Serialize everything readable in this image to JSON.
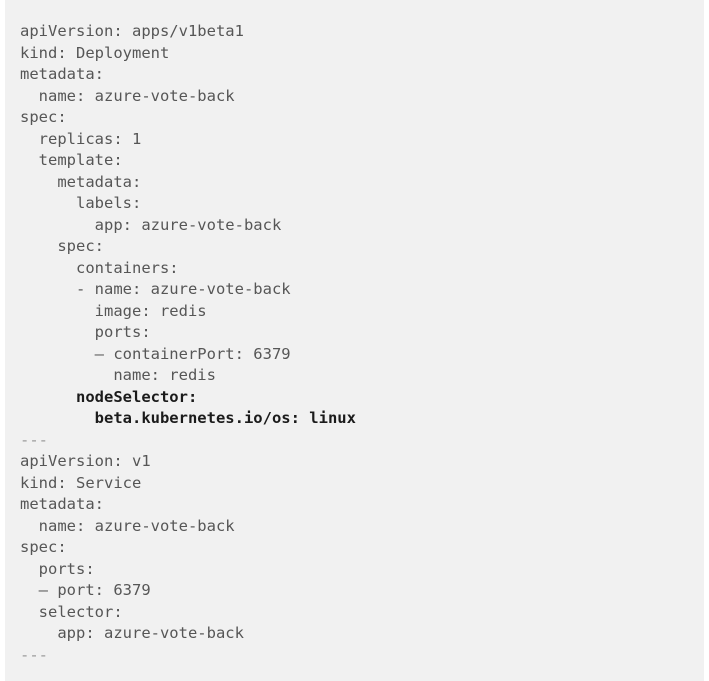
{
  "document": {
    "kind": "code-block",
    "language": "yaml",
    "background_color": "#f1f1f1",
    "page_background_color": "#ffffff",
    "text_color": "#565656",
    "emphasis_color": "#1b1b1b",
    "separator_color": "#9a9a9a",
    "lines": [
      {
        "text": "apiVersion: apps/v1beta1",
        "style": "normal"
      },
      {
        "text": "kind: Deployment",
        "style": "normal"
      },
      {
        "text": "metadata:",
        "style": "normal"
      },
      {
        "text": "  name: azure-vote-back",
        "style": "normal"
      },
      {
        "text": "spec:",
        "style": "normal"
      },
      {
        "text": "  replicas: 1",
        "style": "normal"
      },
      {
        "text": "  template:",
        "style": "normal"
      },
      {
        "text": "    metadata:",
        "style": "normal"
      },
      {
        "text": "      labels:",
        "style": "normal"
      },
      {
        "text": "        app: azure-vote-back",
        "style": "normal"
      },
      {
        "text": "    spec:",
        "style": "normal"
      },
      {
        "text": "      containers:",
        "style": "normal"
      },
      {
        "text": "      - name: azure-vote-back",
        "style": "normal"
      },
      {
        "text": "        image: redis",
        "style": "normal"
      },
      {
        "text": "        ports:",
        "style": "normal"
      },
      {
        "text": "        — containerPort: 6379",
        "style": "normal"
      },
      {
        "text": "          name: redis",
        "style": "normal"
      },
      {
        "text": "      nodeSelector:",
        "style": "bold"
      },
      {
        "text": "        beta.kubernetes.io/os: linux",
        "style": "bold"
      },
      {
        "text": "---",
        "style": "sep"
      },
      {
        "text": "apiVersion: v1",
        "style": "normal"
      },
      {
        "text": "kind: Service",
        "style": "normal"
      },
      {
        "text": "metadata:",
        "style": "normal"
      },
      {
        "text": "  name: azure-vote-back",
        "style": "normal"
      },
      {
        "text": "spec:",
        "style": "normal"
      },
      {
        "text": "  ports:",
        "style": "normal"
      },
      {
        "text": "  — port: 6379",
        "style": "normal"
      },
      {
        "text": "  selector:",
        "style": "normal"
      },
      {
        "text": "    app: azure-vote-back",
        "style": "normal"
      },
      {
        "text": "---",
        "style": "sep"
      }
    ]
  }
}
